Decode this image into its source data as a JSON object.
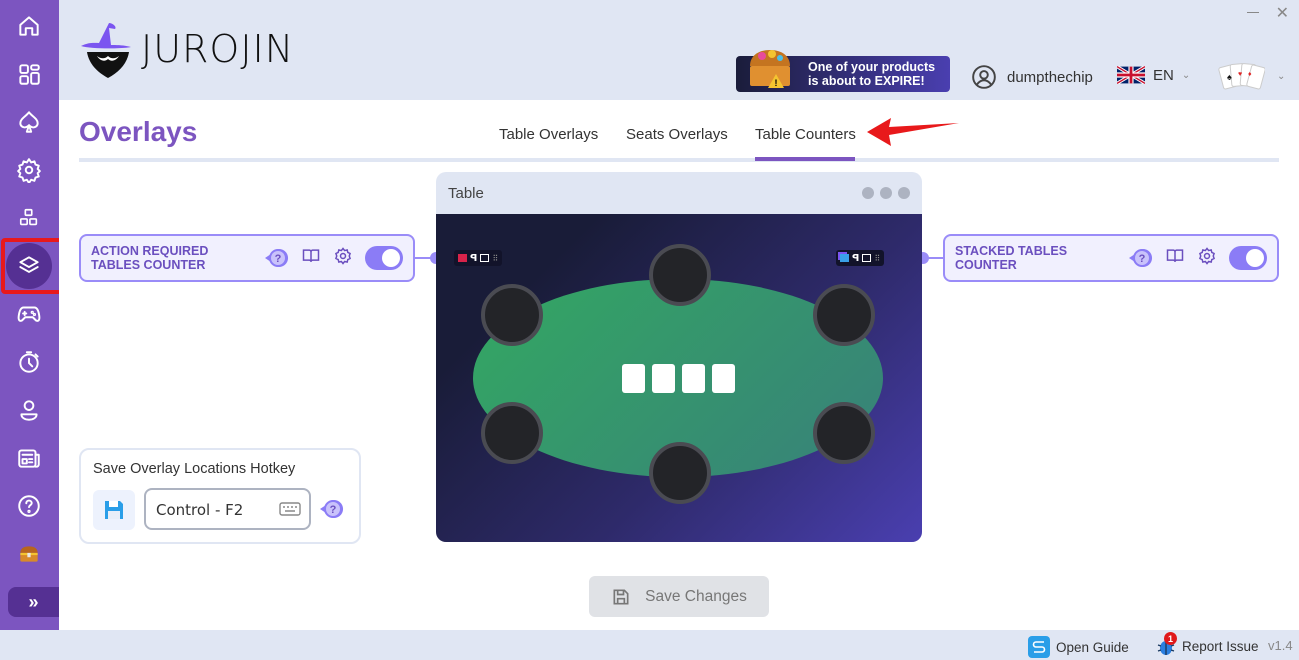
{
  "app": {
    "brand": "JUROJIN",
    "accent": "#7c55c0",
    "secondary_accent": "#9a8cf8"
  },
  "window": {
    "minimize_label": "—",
    "close_label": "✕"
  },
  "sidebar": {
    "items": [
      {
        "icon": "home-icon"
      },
      {
        "icon": "dashboard-icon"
      },
      {
        "icon": "spade-icon"
      },
      {
        "icon": "gear-icon"
      },
      {
        "icon": "apps-icon"
      },
      {
        "icon": "layers-icon",
        "active": true
      },
      {
        "icon": "gamepad-icon"
      },
      {
        "icon": "timer-icon"
      },
      {
        "icon": "user-icon"
      },
      {
        "icon": "news-icon"
      },
      {
        "icon": "help-icon"
      },
      {
        "icon": "treasure-chest-icon"
      }
    ],
    "expand_label": "»"
  },
  "header": {
    "promo": {
      "line1": "One of your products",
      "line2": "is about to EXPIRE!"
    },
    "username": "dumpthechip",
    "language": "EN"
  },
  "page": {
    "title": "Overlays",
    "tabs": [
      {
        "label": "Table Overlays",
        "active": false
      },
      {
        "label": "Seats Overlays",
        "active": false
      },
      {
        "label": "Table Counters",
        "active": true
      }
    ]
  },
  "counters": {
    "left": {
      "line1": "ACTION REQUIRED",
      "line2": "TABLES COUNTER",
      "enabled": true
    },
    "right": {
      "line1": "STACKED TABLES",
      "line2": "COUNTER",
      "enabled": true
    }
  },
  "table_preview": {
    "title": "Table",
    "seats": 6,
    "board_cards": 4
  },
  "hotkey": {
    "label": "Save Overlay Locations Hotkey",
    "value": "Control - F2"
  },
  "save_button": {
    "label": "Save Changes",
    "disabled": true
  },
  "footer": {
    "open_guide": "Open Guide",
    "report_issue": "Report Issue",
    "report_badge": "1",
    "version": "v1.4"
  }
}
